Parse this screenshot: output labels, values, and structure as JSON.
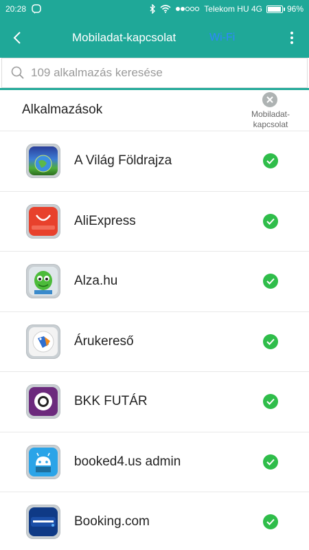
{
  "status_bar": {
    "time": "20:28",
    "carrier": "Telekom HU 4G",
    "battery": "96%",
    "battery_level": 0.96
  },
  "app_bar": {
    "title": "Mobiladat-kapcsolat",
    "wifi_tab": "Wi-Fi"
  },
  "search": {
    "placeholder": "109 alkalmazás keresése"
  },
  "list": {
    "title": "Alkalmazások",
    "column_label": "Mobiladat-\nkapcsolat",
    "items": [
      {
        "name": "A Világ Földrajza",
        "icon": "globe-icon",
        "enabled": true
      },
      {
        "name": "AliExpress",
        "icon": "aliexpress-icon",
        "enabled": true
      },
      {
        "name": "Alza.hu",
        "icon": "alza-alien-icon",
        "enabled": true
      },
      {
        "name": "Árukereső",
        "icon": "price-tag-icon",
        "enabled": true
      },
      {
        "name": "BKK FUTÁR",
        "icon": "bkk-futar-icon",
        "enabled": true
      },
      {
        "name": "booked4.us admin",
        "icon": "android-icon",
        "enabled": true
      },
      {
        "name": "Booking.com",
        "icon": "booking-icon",
        "enabled": true
      }
    ]
  },
  "colors": {
    "accent": "#1fa898",
    "check": "#2fbd4a",
    "wifi_tab": "#2f86ff"
  }
}
